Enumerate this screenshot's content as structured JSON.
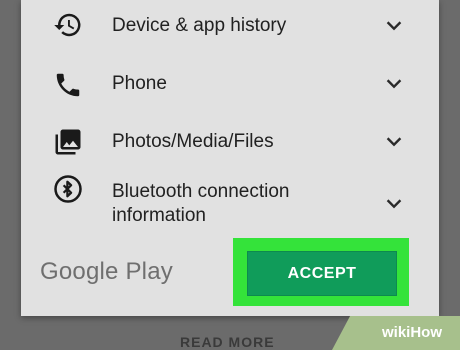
{
  "permissions": [
    {
      "label": "Device & app history",
      "icon": "history-icon"
    },
    {
      "label": "Phone",
      "icon": "phone-icon"
    },
    {
      "label": "Photos/Media/Files",
      "icon": "photos-icon"
    },
    {
      "label": "Bluetooth connection information",
      "icon": "bluetooth-icon"
    }
  ],
  "footer": {
    "logo_text": "Google Play",
    "accept_label": "ACCEPT"
  },
  "background": {
    "read_more_label": "READ MORE"
  },
  "watermark": {
    "text": "wikiHow"
  },
  "colors": {
    "accept": "#109c5a",
    "highlight": "#34e33a",
    "dialog": "#e1e1e1"
  }
}
